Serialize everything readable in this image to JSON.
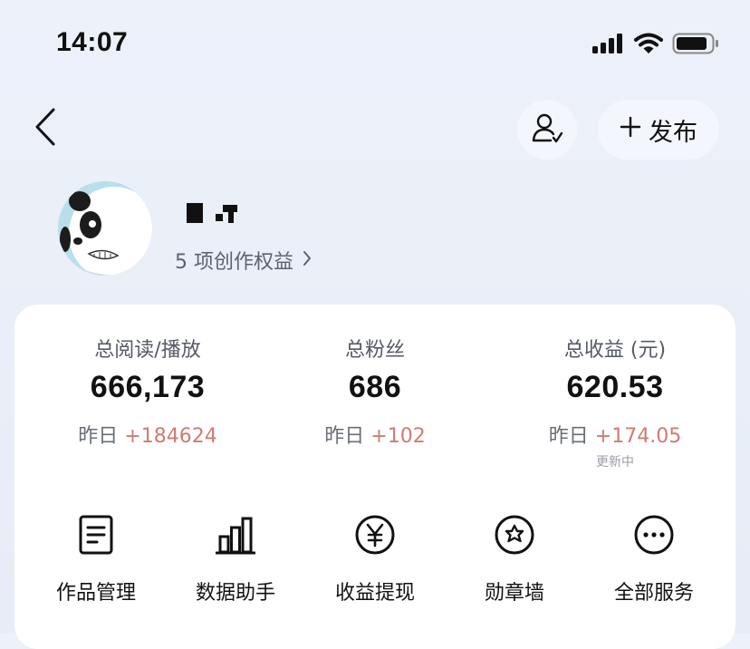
{
  "status_bar": {
    "time": "14:07"
  },
  "nav": {
    "back_icon": "chevron-left-icon",
    "follow_icon": "user-check-icon",
    "publish_label": "发布",
    "publish_icon": "plus-icon"
  },
  "profile": {
    "username": "",
    "benefits_label": "5 项创作权益"
  },
  "stats": [
    {
      "label": "总阅读/播放",
      "value": "666,173",
      "delta_prefix": "昨日",
      "delta": "+184624",
      "note": ""
    },
    {
      "label": "总粉丝",
      "value": "686",
      "delta_prefix": "昨日",
      "delta": "+102",
      "note": ""
    },
    {
      "label": "总收益 (元)",
      "value": "620.53",
      "delta_prefix": "昨日",
      "delta": "+174.05",
      "note": "更新中"
    }
  ],
  "services": [
    {
      "label": "作品管理",
      "icon": "document-icon"
    },
    {
      "label": "数据助手",
      "icon": "bar-chart-icon"
    },
    {
      "label": "收益提现",
      "icon": "yen-coin-icon"
    },
    {
      "label": "勋章墙",
      "icon": "medal-icon"
    },
    {
      "label": "全部服务",
      "icon": "more-icon"
    }
  ],
  "colors": {
    "background": "#eaeff8",
    "card": "#ffffff",
    "delta_positive": "#d07b72",
    "muted_text": "#555a64"
  }
}
